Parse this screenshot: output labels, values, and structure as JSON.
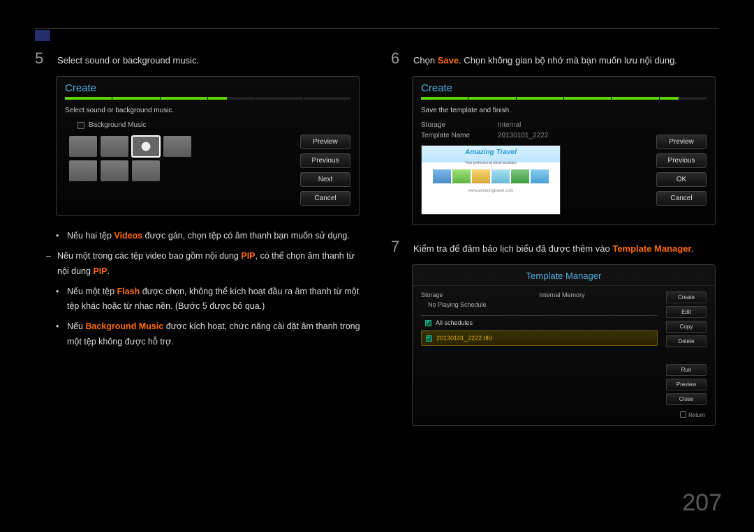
{
  "page_number": "207",
  "left": {
    "step_num": "5",
    "step_text": "Select sound or background music.",
    "screen": {
      "title": "Create",
      "instruction": "Select sound or background music.",
      "bg_music_label": "Background Music",
      "buttons": {
        "preview": "Preview",
        "previous": "Previous",
        "next": "Next",
        "cancel": "Cancel"
      }
    },
    "bullet1_a": "Nếu hai tệp ",
    "bullet1_term": "Videos",
    "bullet1_b": " được gán, chọn tệp có âm thanh bạn muốn sử dụng.",
    "sub1_a": "Nếu một trong các tệp video bao gồm nội dung ",
    "sub1_term1": "PIP",
    "sub1_b": ", có thể chọn âm thanh từ nội dung ",
    "sub1_term2": "PIP",
    "sub1_c": ".",
    "bullet2_a": "Nếu một tệp ",
    "bullet2_term": "Flash",
    "bullet2_b": " được chọn, không thể kích hoạt đầu ra âm thanh từ một tệp khác hoặc từ nhạc nền. (Bước 5 được bỏ qua.)",
    "bullet3_a": "Nếu ",
    "bullet3_term": "Background Music",
    "bullet3_b": " được kích hoạt, chức năng cài đặt âm thanh trong một tệp không được hỗ trợ."
  },
  "right": {
    "step6_num": "6",
    "step6_a": "Chọn ",
    "step6_term": "Save",
    "step6_b": ". Chọn không gian bộ nhớ mà bạn muốn lưu nội dung.",
    "screen6": {
      "title": "Create",
      "instruction": "Save the template and finish.",
      "storage_label": "Storage",
      "storage_val": "Internal",
      "tname_label": "Template Name",
      "tname_val": "20130101_2222",
      "preview_title": "Amazing Travel",
      "preview_sub": "Your professional travel assistant",
      "preview_url": "www.amazingtravel.com",
      "buttons": {
        "preview": "Preview",
        "previous": "Previous",
        "ok": "OK",
        "cancel": "Cancel"
      }
    },
    "step7_num": "7",
    "step7_a": "Kiểm tra để đảm bảo lịch biểu đã được thêm vào ",
    "step7_term": "Template Manager",
    "step7_b": ".",
    "tm": {
      "title": "Template Manager",
      "storage_label": "Storage",
      "storage_val": "Internal Memory",
      "no_playing": "No Playing Schedule",
      "all_schedules": "All schedules",
      "item": "20130101_2222.tffd",
      "buttons": {
        "create": "Create",
        "edit": "Edit",
        "copy": "Copy",
        "delete": "Delete",
        "run": "Run",
        "preview": "Preview",
        "close": "Close"
      },
      "return": "Return"
    }
  }
}
